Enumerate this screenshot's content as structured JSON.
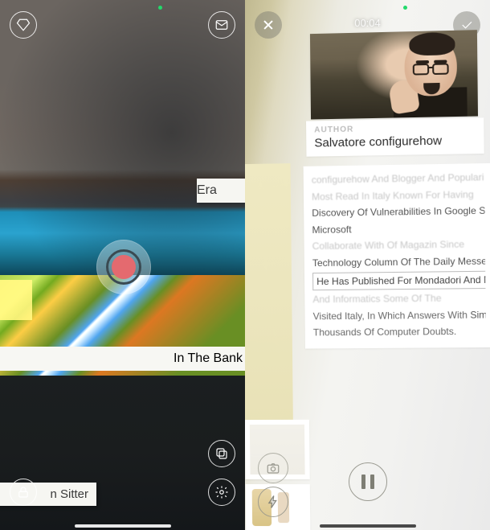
{
  "left": {
    "status_indicator": "recording-indicator",
    "icons": {
      "diamond": "diamond-icon",
      "mail": "mail-icon",
      "copy": "copy-icon",
      "lock": "lock-icon",
      "gear": "gear-icon",
      "record": "record-button"
    },
    "background_snippets": {
      "snippet1": "Era",
      "snippet2_label": "In The Bank",
      "snippet3": "n Sitter"
    }
  },
  "right": {
    "timer": "00:04",
    "controls": {
      "close": "close-icon",
      "confirm": "check-icon",
      "camera": "camera-icon",
      "flash": "flash-icon",
      "pause": "pause-icon"
    },
    "article": {
      "author_label": "AUTHOR",
      "author_name": "Salvatore configurehow",
      "lines": {
        "l1": "configurehow And Blogger And Popularizer",
        "l2a": "Most Read",
        "l2b": "In Italy Known For Having",
        "l3": "Discovery Of Vulnerabilities In Google Sites",
        "l4": "Microsoft",
        "l5a": "Collaborate With",
        "l5b": "Of Magazin",
        "l5c": "Since",
        "l6": "Technology Column Of The Daily Messenger",
        "l7": "He Has Published For Mondadori And Mondadori",
        "l8a": "And",
        "l8b": "Informatics",
        "l8c": "Some Of",
        "l8d": "The",
        "l9a": "Visited Italy, In Which Answers With",
        "l9b": "Simplicity",
        "l10": "Thousands Of Computer Doubts."
      }
    }
  }
}
